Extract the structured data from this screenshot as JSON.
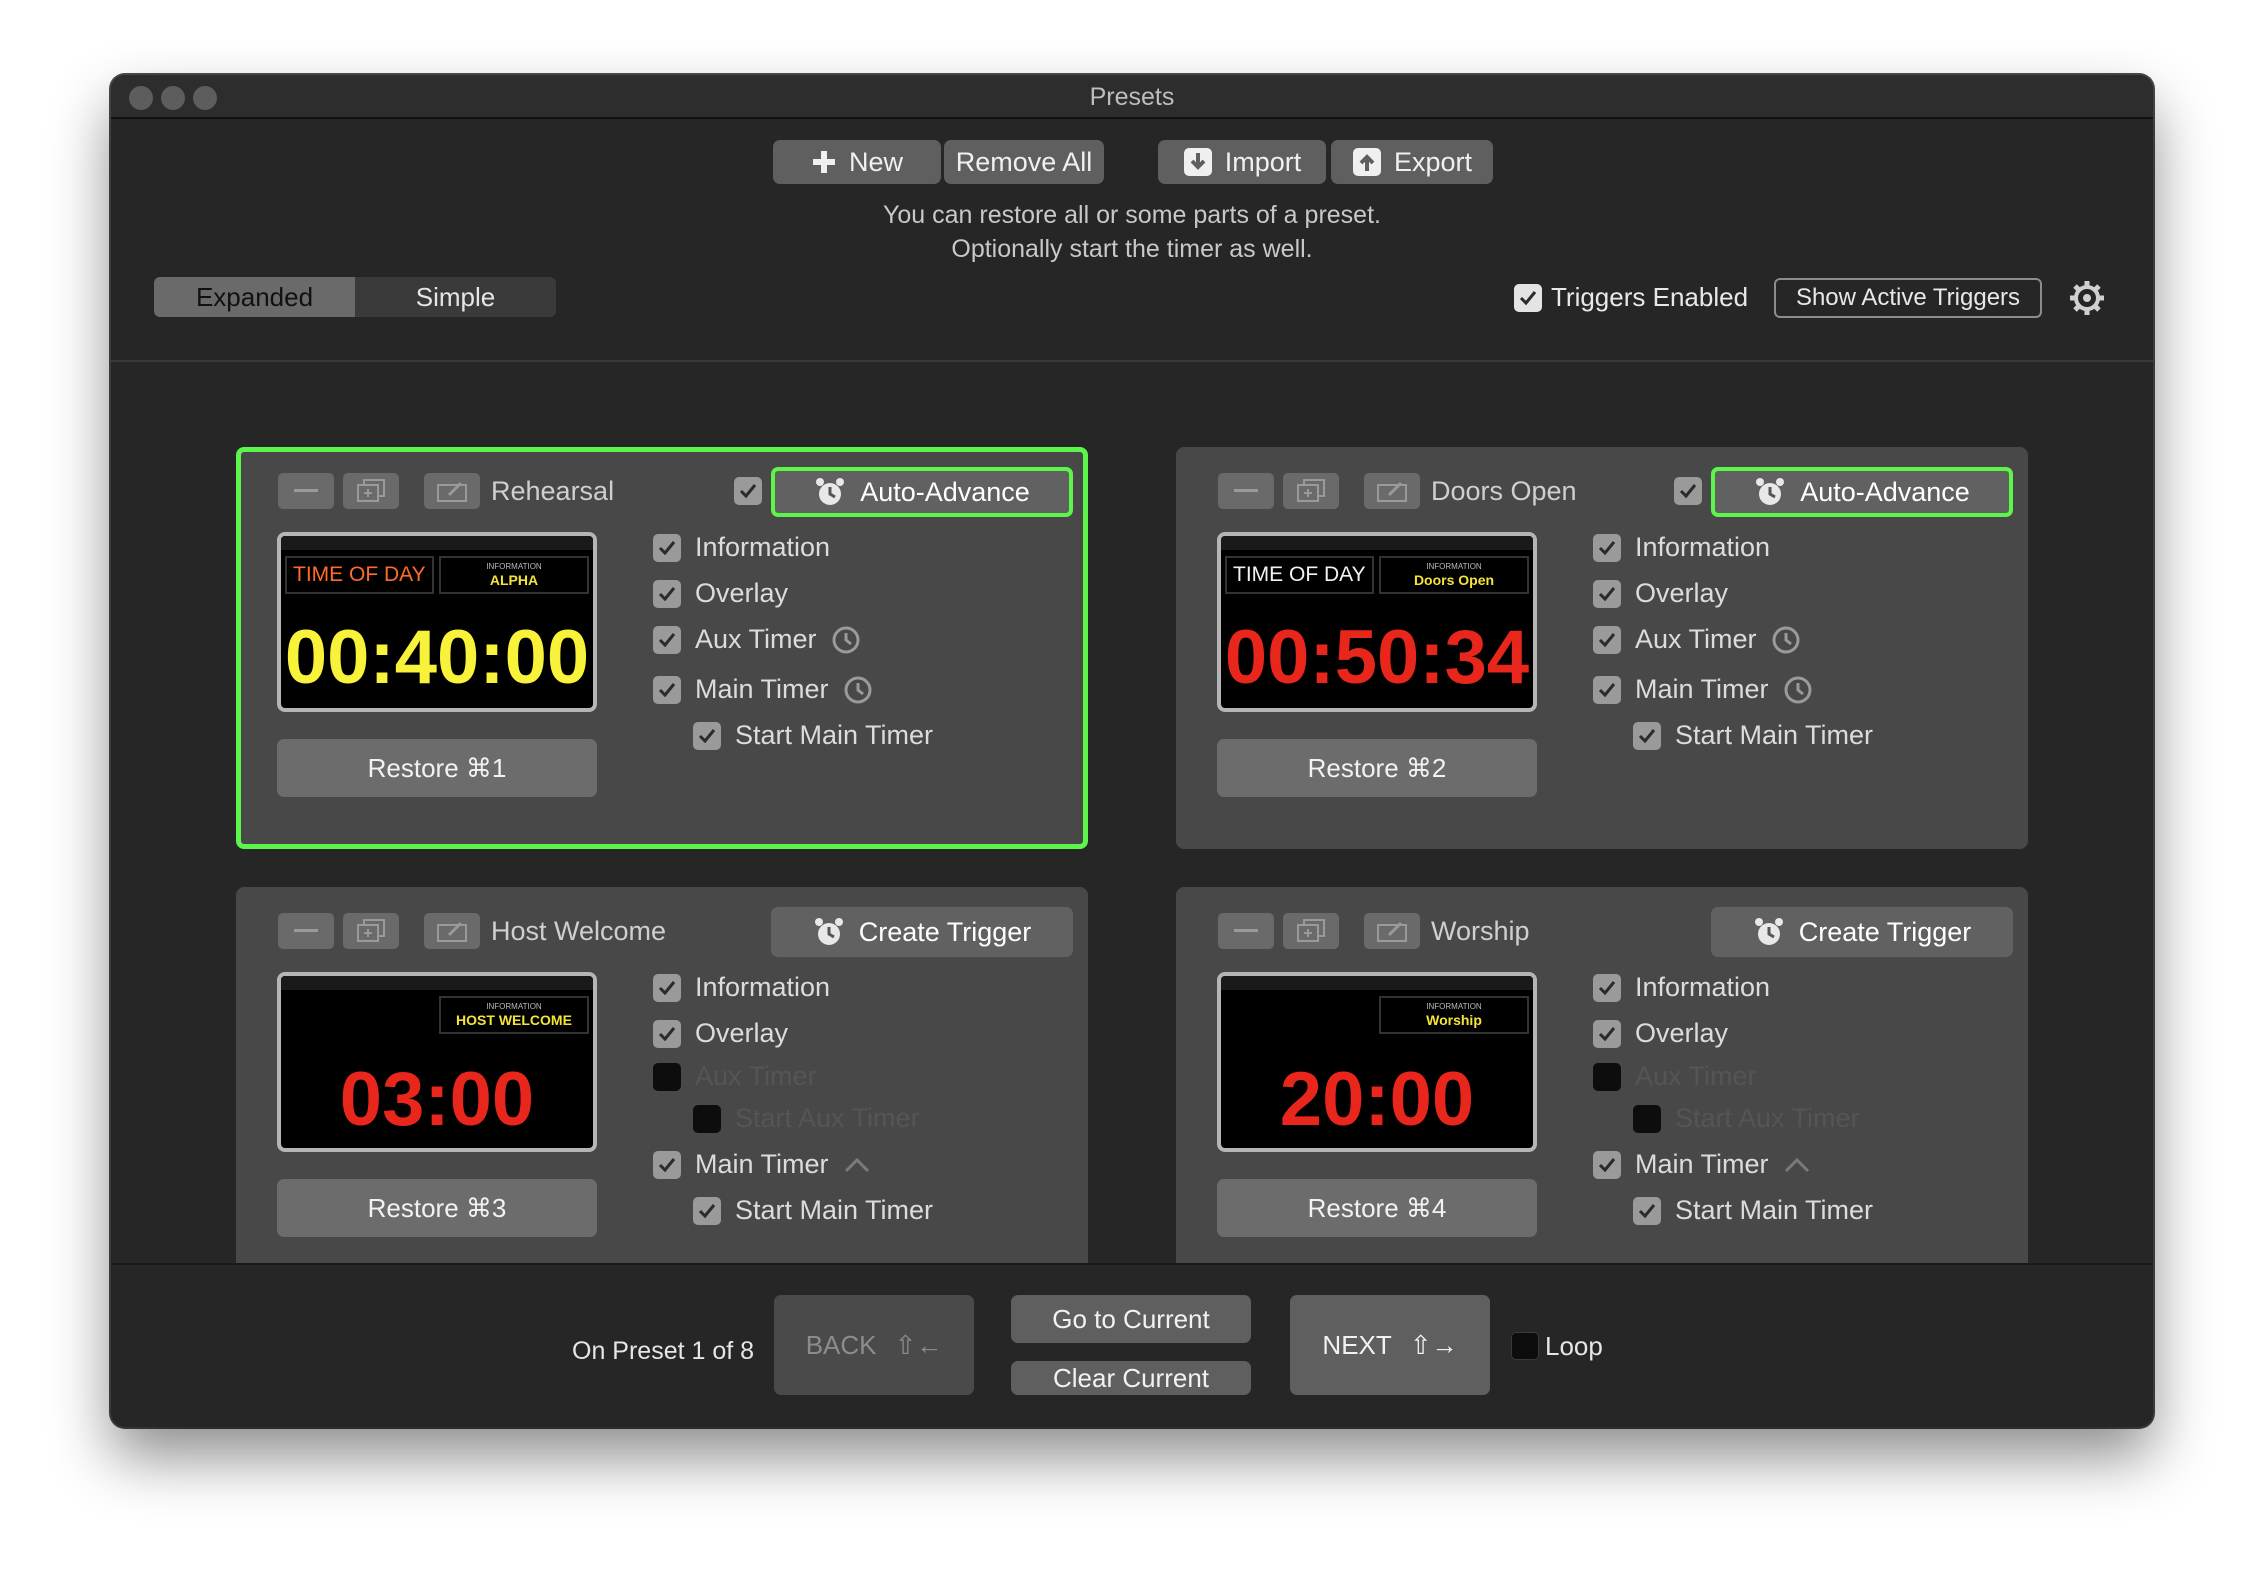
{
  "window": {
    "title": "Presets"
  },
  "toolbar": {
    "new_label": "New",
    "remove_all_label": "Remove All",
    "import_label": "Import",
    "export_label": "Export",
    "hint_line1": "You can restore all or some parts of a preset.",
    "hint_line2": "Optionally start the timer as well."
  },
  "view_mode": {
    "options": [
      "Expanded",
      "Simple"
    ],
    "selected": "Expanded"
  },
  "triggers": {
    "enabled_label": "Triggers Enabled",
    "enabled": true,
    "show_active_label": "Show Active Triggers"
  },
  "presets": [
    {
      "name": "Rehearsal",
      "active": true,
      "trigger_enabled": true,
      "action_label": "Auto-Advance",
      "preview": {
        "tod_label": "TIME OF DAY",
        "info_label": "INFORMATION",
        "info_value": "ALPHA",
        "time": "00:40:00",
        "time_color": "#f8f23a"
      },
      "restore_label": "Restore ⌘1",
      "options": {
        "information": "Information",
        "overlay": "Overlay",
        "aux_timer": "Aux Timer",
        "main_timer": "Main Timer",
        "start_main_timer": "Start Main Timer"
      }
    },
    {
      "name": "Doors Open",
      "active": false,
      "trigger_enabled": true,
      "action_label": "Auto-Advance",
      "preview": {
        "tod_label": "TIME OF DAY",
        "info_label": "INFORMATION",
        "info_value": "Doors Open",
        "time": "00:50:34",
        "time_color": "#e8261c"
      },
      "restore_label": "Restore ⌘2",
      "options": {
        "information": "Information",
        "overlay": "Overlay",
        "aux_timer": "Aux Timer",
        "main_timer": "Main Timer",
        "start_main_timer": "Start Main Timer"
      }
    },
    {
      "name": "Host Welcome",
      "active": false,
      "action_label": "Create Trigger",
      "preview": {
        "info_label": "INFORMATION",
        "info_value": "HOST WELCOME",
        "time": "03:00",
        "time_color": "#e8261c"
      },
      "restore_label": "Restore ⌘3",
      "options": {
        "information": "Information",
        "overlay": "Overlay",
        "aux_timer": "Aux Timer",
        "start_aux_timer": "Start Aux Timer",
        "main_timer": "Main Timer",
        "start_main_timer": "Start Main Timer"
      }
    },
    {
      "name": "Worship",
      "active": false,
      "action_label": "Create Trigger",
      "preview": {
        "info_label": "INFORMATION",
        "info_value": "Worship",
        "time": "20:00",
        "time_color": "#e8261c"
      },
      "restore_label": "Restore ⌘4",
      "options": {
        "information": "Information",
        "overlay": "Overlay",
        "aux_timer": "Aux Timer",
        "start_aux_timer": "Start Aux Timer",
        "main_timer": "Main Timer",
        "start_main_timer": "Start Main Timer"
      }
    }
  ],
  "footer": {
    "status": "On Preset 1 of 8",
    "back_label": "BACK",
    "back_shortcut": "⇧←",
    "go_current_label": "Go to Current",
    "clear_current_label": "Clear Current",
    "next_label": "NEXT",
    "next_shortcut": "⇧→",
    "loop_label": "Loop",
    "loop_enabled": false
  },
  "colors": {
    "accent_green": "#5cf54a",
    "yellow_time": "#f8f23a",
    "red_time": "#e8261c",
    "orange_tod": "#ff6b2b"
  }
}
